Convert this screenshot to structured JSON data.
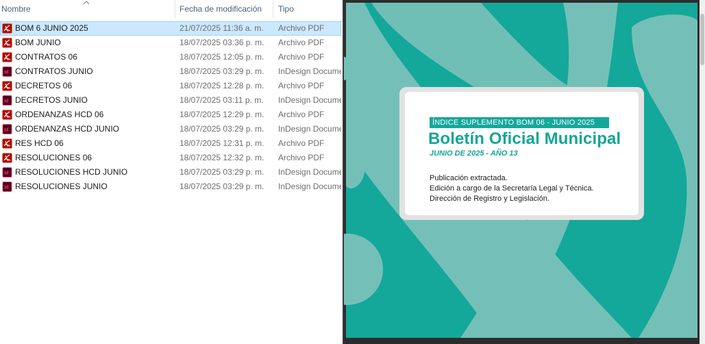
{
  "columns": {
    "name": "Nombre",
    "date": "Fecha de modificación",
    "type": "Tipo"
  },
  "files": [
    {
      "name": "BOM 6 JUNIO 2025",
      "date": "21/07/2025 11:36 a. m.",
      "type": "Archivo PDF",
      "icon": "pdf-icon",
      "selected": true
    },
    {
      "name": "BOM JUNIO",
      "date": "18/07/2025 03:36 p. m.",
      "type": "Archivo PDF",
      "icon": "pdf-icon"
    },
    {
      "name": "CONTRATOS 06",
      "date": "18/07/2025 12:05 p. m.",
      "type": "Archivo PDF",
      "icon": "pdf-icon"
    },
    {
      "name": "CONTRATOS JUNIO",
      "date": "18/07/2025 03:29 p. m.",
      "type": "InDesign Document",
      "icon": "indesign-icon"
    },
    {
      "name": "DECRETOS 06",
      "date": "18/07/2025 12:28 p. m.",
      "type": "Archivo PDF",
      "icon": "pdf-icon"
    },
    {
      "name": "DECRETOS JUNIO",
      "date": "18/07/2025 03:11 p. m.",
      "type": "InDesign Document",
      "icon": "indesign-icon"
    },
    {
      "name": "ORDENANZAS HCD 06",
      "date": "18/07/2025 12:29 p. m.",
      "type": "Archivo PDF",
      "icon": "pdf-icon"
    },
    {
      "name": "ORDENANZAS HCD JUNIO",
      "date": "18/07/2025 03:29 p. m.",
      "type": "InDesign Document",
      "icon": "indesign-icon"
    },
    {
      "name": "RES HCD 06",
      "date": "18/07/2025 12:31 p. m.",
      "type": "Archivo PDF",
      "icon": "pdf-icon"
    },
    {
      "name": "RESOLUCIONES 06",
      "date": "18/07/2025 12:32 p. m.",
      "type": "Archivo PDF",
      "icon": "pdf-icon"
    },
    {
      "name": "RESOLUCIONES HCD JUNIO",
      "date": "18/07/2025 03:29 p. m.",
      "type": "InDesign Document",
      "icon": "indesign-icon"
    },
    {
      "name": "RESOLUCIONES JUNIO",
      "date": "18/07/2025 03:29 p. m.",
      "type": "InDesign Document",
      "icon": "indesign-icon"
    }
  ],
  "preview": {
    "banner": "ÍNDICE SUPLEMENTO BOM 06 - JUNIO 2025",
    "title": "Boletín Oficial Municipal",
    "subtitle": "JUNIO DE 2025 - AÑO 13",
    "body": [
      "Publicación extractada.",
      "Edición a cargo de la Secretaría Legal y Técnica.",
      "Dirección de Registro y Legislación."
    ]
  },
  "colors": {
    "accent": "#15a597",
    "bg_teal": "#14a89a",
    "shape_light": "#74c0b8",
    "selection": "#cce8ff",
    "pdf_red": "#b30b00",
    "indesign_bg": "#49021f",
    "indesign_fg": "#ff3366"
  }
}
